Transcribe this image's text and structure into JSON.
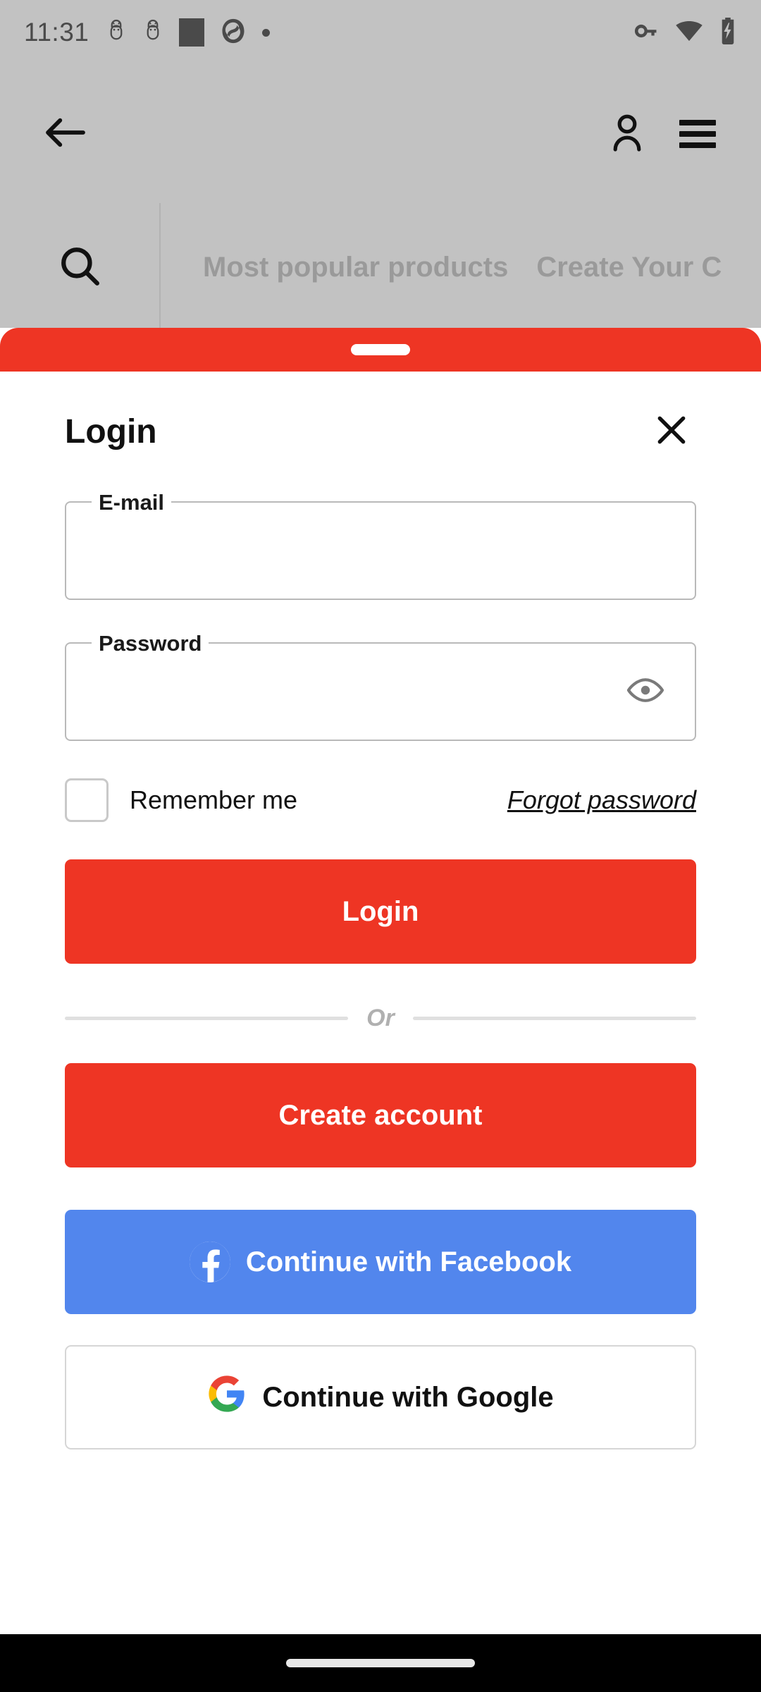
{
  "status_bar": {
    "time": "11:31",
    "left_icons": [
      "android-bug-icon",
      "android-bug-icon",
      "square-icon",
      "aperture-icon",
      "dot-icon"
    ],
    "right_icons": [
      "vpn-key-icon",
      "wifi-icon",
      "battery-charging-icon"
    ]
  },
  "app_bar": {
    "back_icon": "back-arrow-icon",
    "account_icon": "person-icon",
    "menu_icon": "hamburger-menu-icon"
  },
  "strip": {
    "search_icon": "search-icon",
    "tabs": [
      {
        "label": "Most popular products"
      },
      {
        "label": "Create Your C"
      }
    ]
  },
  "sheet": {
    "grabber": "drag-handle",
    "title": "Login",
    "close_icon": "close-icon",
    "fields": {
      "email": {
        "label": "E-mail",
        "value": "",
        "placeholder": ""
      },
      "password": {
        "label": "Password",
        "value": "",
        "placeholder": "",
        "toggle_icon": "eye-icon"
      }
    },
    "remember": {
      "label": "Remember me",
      "checked": false
    },
    "forgot_password": "Forgot password",
    "login_button": "Login",
    "divider_text": "Or",
    "create_account_button": "Create account",
    "facebook_button": "Continue with Facebook",
    "google_button": "Continue with Google"
  },
  "nav_bar": {
    "gesture_pill": "home-gesture-pill"
  },
  "colors": {
    "brand_red": "#ee3524",
    "facebook_blue": "#5286ed",
    "background_dim": "#c2c2c2",
    "nav_black": "#000000",
    "google_blue": "#4285f4",
    "google_green": "#34a853",
    "google_yellow": "#fbbc05",
    "google_red": "#ea4335"
  }
}
